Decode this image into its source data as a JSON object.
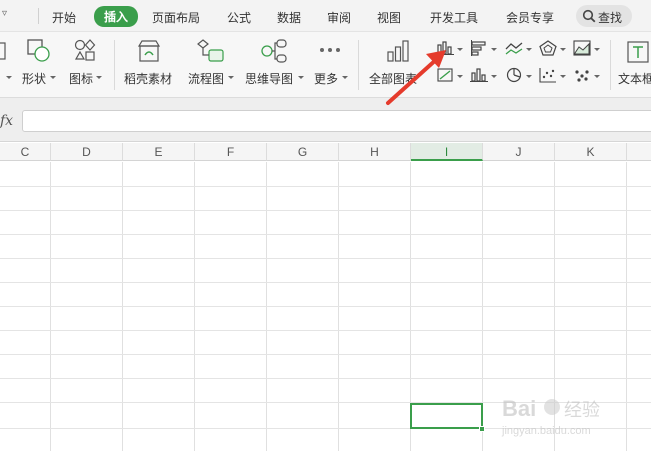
{
  "menubar": {
    "tabs": [
      {
        "label": "开始"
      },
      {
        "label": "插入"
      },
      {
        "label": "页面布局"
      },
      {
        "label": "公式"
      },
      {
        "label": "数据"
      },
      {
        "label": "审阅"
      },
      {
        "label": "视图"
      },
      {
        "label": "开发工具"
      },
      {
        "label": "会员专享"
      }
    ],
    "active_tab": "插入",
    "search_label": "查找"
  },
  "toolbar": {
    "shape_label": "形状",
    "icon_label": "图标",
    "materials_label": "稻壳素材",
    "flowchart_label": "流程图",
    "mindmap_label": "思维导图",
    "more_label": "更多",
    "all_charts_label": "全部图表",
    "textbox_label": "文本框"
  },
  "formula": {
    "fx_label": "fx",
    "value": ""
  },
  "columns": [
    "C",
    "D",
    "E",
    "F",
    "G",
    "H",
    "I",
    "J",
    "K"
  ],
  "selected_column": "I",
  "colors": {
    "accent": "#3a9e4b",
    "arrow": "#e53b2c"
  },
  "watermark": {
    "brand": "Bai",
    "brand2": "经验",
    "url": "jingyan.baidu.com"
  }
}
